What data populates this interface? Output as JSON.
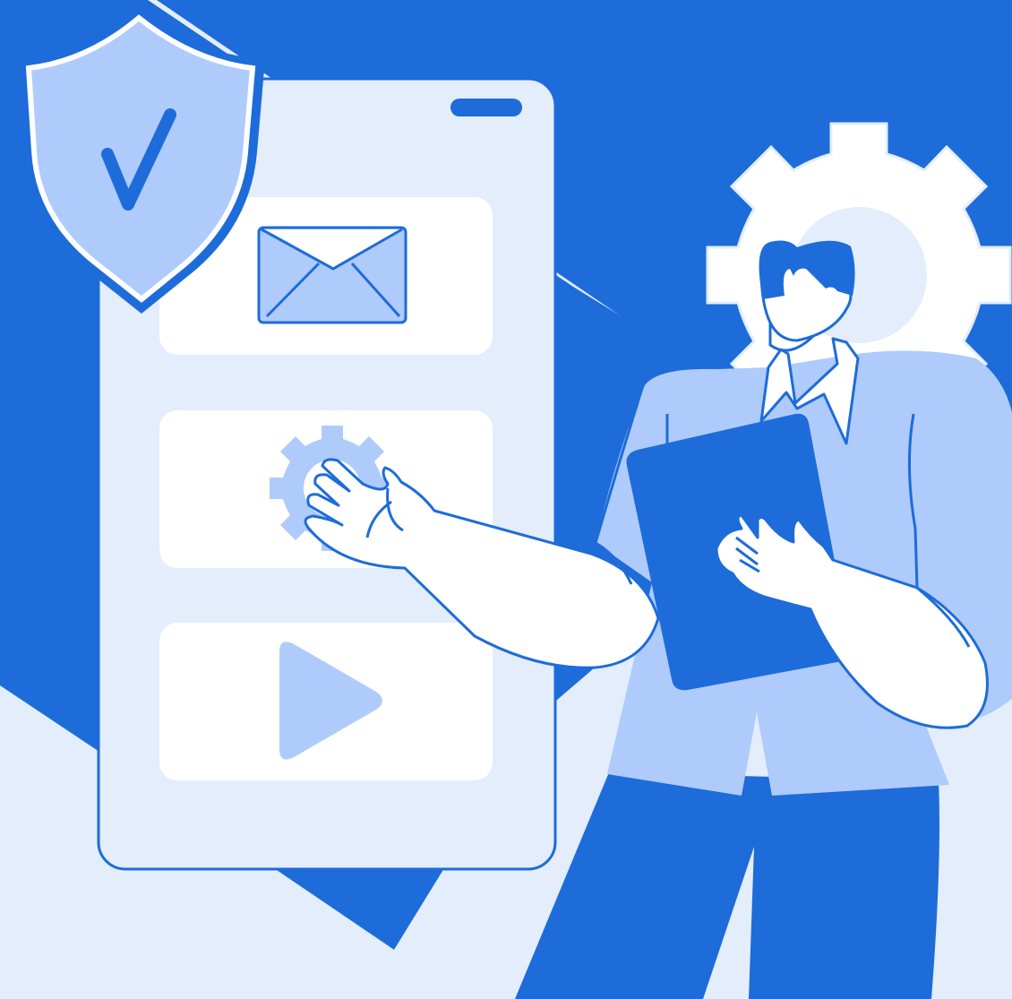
{
  "colors": {
    "background": "#e3edfc",
    "primary_blue": "#1d6cd9",
    "light_blue": "#aecbfc",
    "white": "#ffffff",
    "outline": "#1d6cd9"
  },
  "icons": {
    "shield": "shield-check-icon",
    "envelope": "envelope-icon",
    "settings": "gear-icon",
    "play": "play-icon",
    "background_gear": "gear-icon"
  }
}
